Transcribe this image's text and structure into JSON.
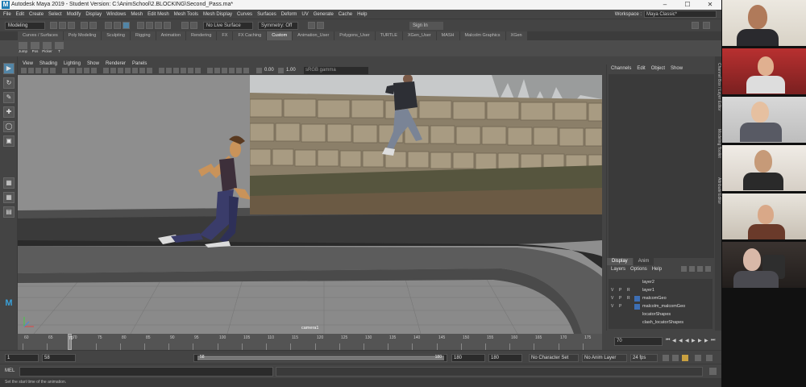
{
  "window": {
    "title": "Autodesk Maya 2019 - Student Version: C:\\AnimSchool\\2.BLOCKING\\Second_Pass.ma*",
    "logo_letter": "M",
    "controls": [
      "–",
      "☐",
      "✕"
    ]
  },
  "menubar": {
    "items": [
      "File",
      "Edit",
      "Create",
      "Select",
      "Modify",
      "Display",
      "Windows",
      "Mesh",
      "Edit Mesh",
      "Mesh Tools",
      "Mesh Display",
      "Curves",
      "Surfaces",
      "Deform",
      "UV",
      "Generate",
      "Cache",
      "Help"
    ],
    "workspace_label": "Workspace :",
    "workspace_value": "Maya Classic*"
  },
  "statusline": {
    "mode": "Modeling",
    "live_surface": "No Live Surface",
    "symmetry": "Symmetry: Off",
    "sign_in": "Sign In"
  },
  "shelf": {
    "tabs": [
      "Curves / Surfaces",
      "Poly Modeling",
      "Sculpting",
      "Rigging",
      "Animation",
      "Rendering",
      "FX",
      "FX Caching",
      "Custom",
      "Animation_User",
      "Polygons_User",
      "TURTLE",
      "XGen_User",
      "MASH",
      "Malcolm Graphics",
      "XGen"
    ],
    "active_tab": "Custom",
    "icons": [
      "Jump",
      "Pos",
      "Picker",
      "T"
    ]
  },
  "viewport": {
    "menu": [
      "View",
      "Shading",
      "Lighting",
      "Show",
      "Renderer",
      "Panels"
    ],
    "exposure": "0.00",
    "gamma": "1.00",
    "color_space": "sRGB gamma",
    "camera_label": "camera1"
  },
  "channel_box": {
    "menu": [
      "Channels",
      "Edit",
      "Object",
      "Show"
    ],
    "layer_tabs": [
      "Display",
      "Anim"
    ],
    "active_layer_tab": "Display",
    "layer_menu": [
      "Layers",
      "Options",
      "Help"
    ],
    "layers": [
      {
        "v": "",
        "p": "",
        "r": "",
        "name": "layer2",
        "color": ""
      },
      {
        "v": "V",
        "p": "P",
        "r": "R",
        "name": "layer1",
        "color": ""
      },
      {
        "v": "V",
        "p": "P",
        "r": "R",
        "name": "malcomGeo",
        "color": "#3d6fb5"
      },
      {
        "v": "V",
        "p": "P",
        "r": "",
        "name": "malcolm_malcomGeo",
        "color": "#3d6fb5"
      },
      {
        "v": "",
        "p": "",
        "r": "",
        "name": "locatorShapes",
        "color": ""
      },
      {
        "v": "",
        "p": "",
        "r": "",
        "name": "clash_locatorShapes",
        "color": ""
      }
    ]
  },
  "side_tabs": [
    "Channel Box / Layer Editor",
    "Modeling Toolkit",
    "Attribute Editor"
  ],
  "timeslider": {
    "ticks": [
      "60",
      "65",
      "70",
      "75",
      "80",
      "85",
      "90",
      "95",
      "100",
      "105",
      "110",
      "115",
      "120",
      "125",
      "130",
      "135",
      "140",
      "145",
      "150",
      "155",
      "160",
      "165",
      "170",
      "175"
    ],
    "current_frame_marker": "70",
    "current_frame": "70"
  },
  "range": {
    "start": "1",
    "anim_start": "58",
    "range_start": "58",
    "range_end": "180",
    "anim_end": "180",
    "end": "180",
    "character_set": "No Character Set",
    "anim_layer": "No Anim Layer",
    "fps": "24 fps"
  },
  "command": {
    "label": "MEL",
    "help": "Set the start time of the animation."
  }
}
